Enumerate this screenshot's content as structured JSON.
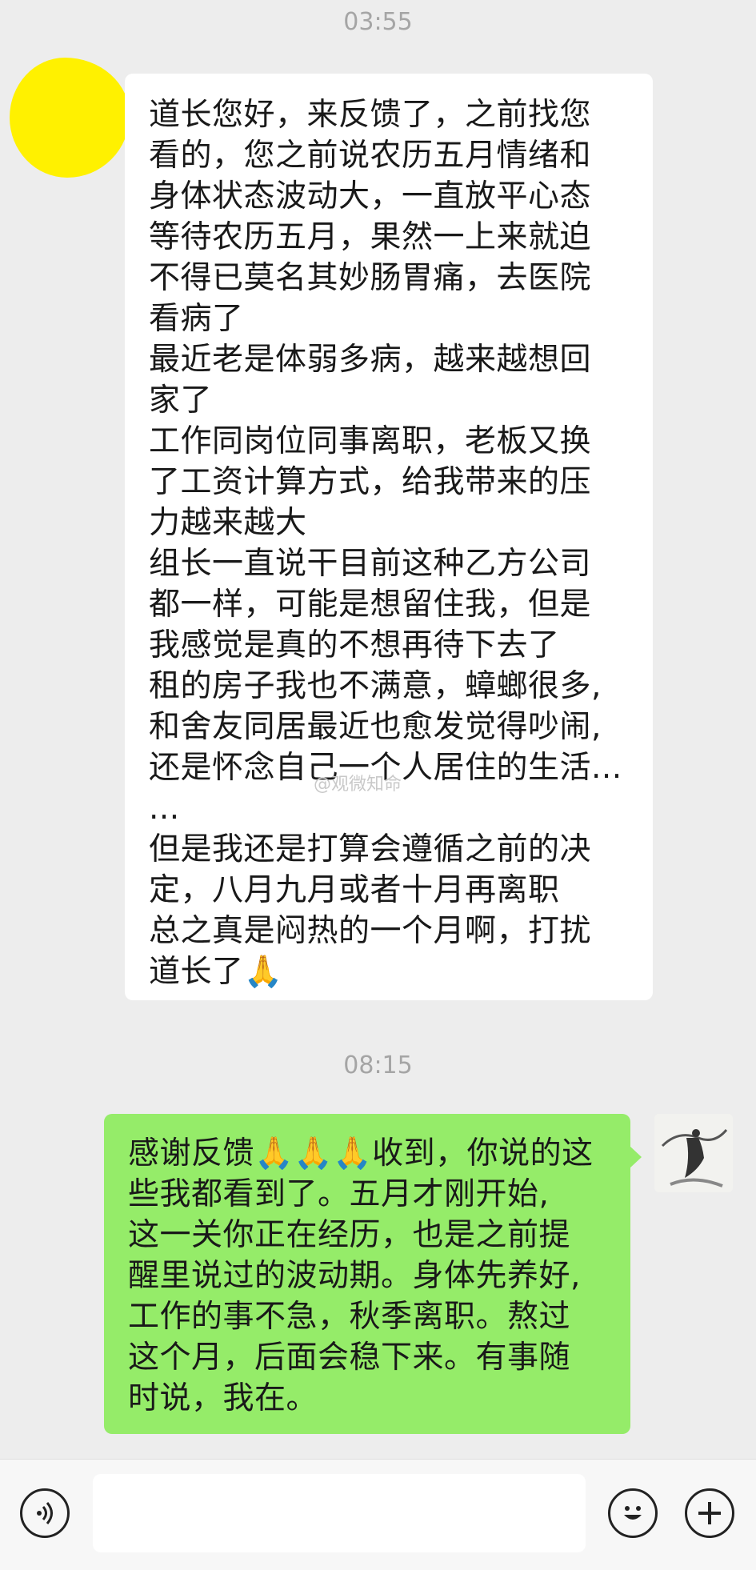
{
  "timestamps": [
    "03:55",
    "08:15"
  ],
  "incoming_message": {
    "lines": [
      "道长您好，来反馈了，之前找您",
      "看的，您之前说农历五月情绪和",
      "身体状态波动大，一直放平心态",
      "等待农历五月，果然一上来就迫",
      "不得已莫名其妙肠胃痛，去医院",
      "看病了",
      "最近老是体弱多病，越来越想回",
      "家了",
      "工作同岗位同事离职，老板又换",
      "了工资计算方式，给我带来的压",
      "力越来越大",
      "组长一直说干目前这种乙方公司",
      "都一样，可能是想留住我，但是",
      "我感觉是真的不想再待下去了",
      "租的房子我也不满意，蟑螂很多,",
      "和舍友同居最近也愈发觉得吵闹,",
      "还是怀念自己一个人居住的生活...",
      "...",
      "但是我还是打算会遵循之前的决",
      "定，八月九月或者十月再离职",
      "总之真是闷热的一个月啊，打扰",
      "道长了🙏"
    ]
  },
  "outgoing_message": {
    "lines": [
      "感谢反馈🙏🙏🙏收到，你说的这",
      "些我都看到了。五月才刚开始,",
      "这一关你正在经历，也是之前提",
      "醒里说过的波动期。身体先养好,",
      "工作的事不急，秋季离职。熬过",
      "这个月，后面会稳下来。有事随",
      "时说，我在。"
    ]
  },
  "watermark": "@观微知命",
  "input_bar": {
    "voice_icon": "voice-icon",
    "emoji_icon": "emoji-icon",
    "plus_icon": "plus-icon",
    "placeholder": ""
  }
}
